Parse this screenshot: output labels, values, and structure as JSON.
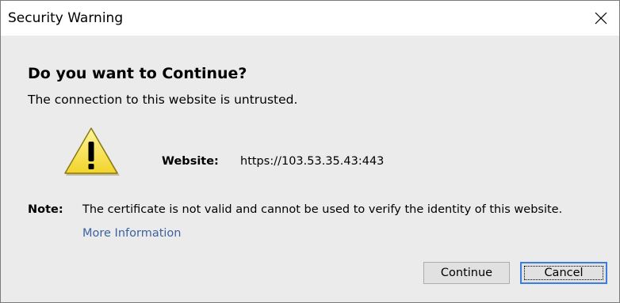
{
  "window": {
    "title": "Security Warning"
  },
  "dialog": {
    "heading": "Do you want to Continue?",
    "subheading": "The connection to this website is untrusted.",
    "icon": "warning-icon",
    "website_label": "Website:",
    "website_value": "https://103.53.35.43:443",
    "note_label": "Note:",
    "note_text": "The certificate is not valid and cannot be used to verify the identity of this website.",
    "more_info_link": "More Information"
  },
  "buttons": {
    "continue_label": "Continue",
    "cancel_label": "Cancel"
  },
  "colors": {
    "background": "#ebebeb",
    "titlebar": "#ffffff",
    "link": "#3d62a0",
    "focus_border": "#3c7ee0",
    "warning_fill": "#f8e24c"
  }
}
